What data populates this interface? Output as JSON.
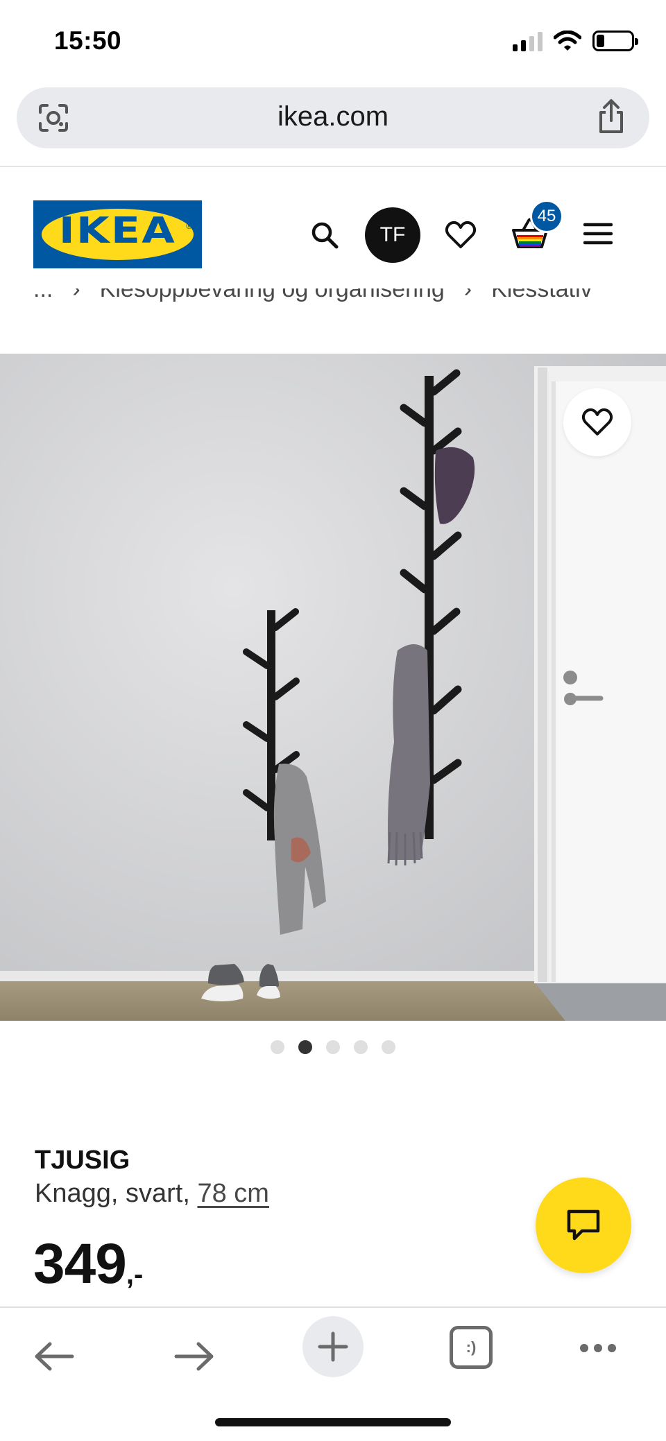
{
  "status_bar": {
    "time": "15:50",
    "battery_level": 0.22,
    "signal_bars_active": 2,
    "signal_bars_total": 4
  },
  "browser": {
    "url": "ikea.com"
  },
  "header": {
    "logo_text": "IKEA",
    "logo_registered": "®",
    "avatar_initials": "TF",
    "basket_count": "45",
    "brand_colors": {
      "blue": "#0058a3",
      "yellow": "#ffda1a"
    }
  },
  "breadcrumb": {
    "items": [
      "...",
      "Klesoppbevaring og organisering",
      "Klesstativ"
    ],
    "separator": "›"
  },
  "carousel": {
    "total_images": 5,
    "active_index": 1
  },
  "product": {
    "name": "TJUSIG",
    "description": "Knagg, svart, ",
    "size_link": "78 cm",
    "price": "349",
    "price_suffix": ",-"
  },
  "toolbar": {
    "tabs_label": ":)"
  }
}
